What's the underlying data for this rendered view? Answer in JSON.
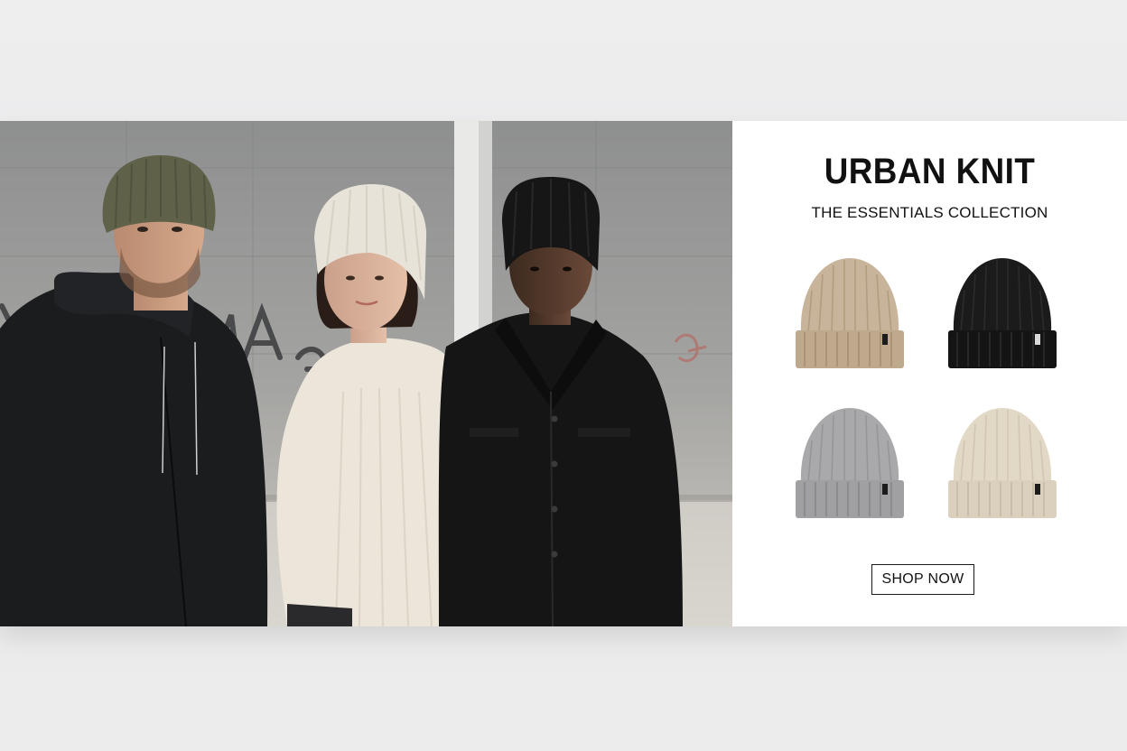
{
  "banner": {
    "title": "URBAN KNIT",
    "subtitle": "THE ESSENTIALS COLLECTION",
    "cta_label": "SHOP NOW"
  },
  "products": [
    {
      "name": "beanie-tan",
      "color": "#c8b49a"
    },
    {
      "name": "beanie-black",
      "color": "#1b1b1b"
    },
    {
      "name": "beanie-grey",
      "color": "#a9a9ab"
    },
    {
      "name": "beanie-cream",
      "color": "#e2d8c6"
    }
  ],
  "photo": {
    "models": [
      {
        "name": "model-olive-beanie",
        "hat_color": "#5f6249",
        "top_color": "#1c1d1f"
      },
      {
        "name": "model-cream-beanie",
        "hat_color": "#e8e3d9",
        "top_color": "#eee7dc"
      },
      {
        "name": "model-black-beanie",
        "hat_color": "#161616",
        "top_color": "#151515"
      }
    ]
  }
}
